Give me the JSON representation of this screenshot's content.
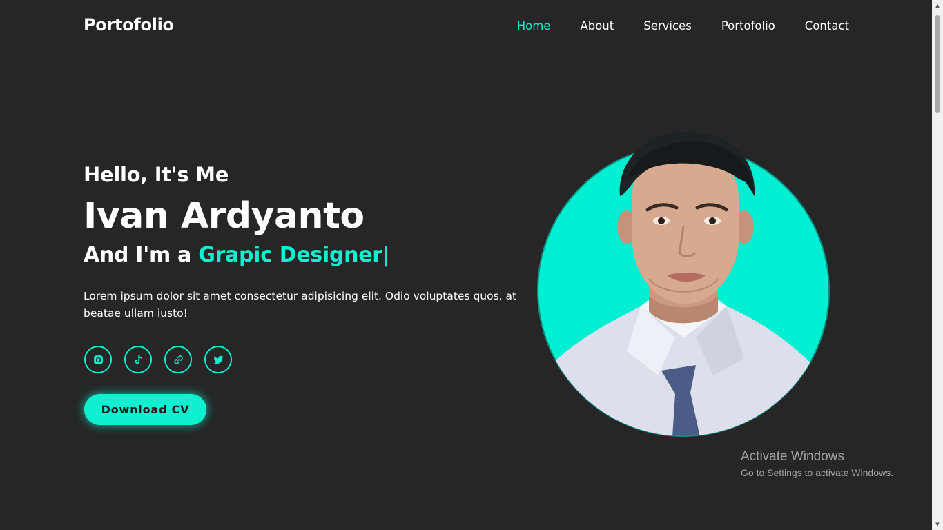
{
  "header": {
    "logo": "Portofolio",
    "nav": [
      {
        "label": "Home",
        "active": true
      },
      {
        "label": "About",
        "active": false
      },
      {
        "label": "Services",
        "active": false
      },
      {
        "label": "Portofolio",
        "active": false
      },
      {
        "label": "Contact",
        "active": false
      }
    ]
  },
  "hero": {
    "greeting": "Hello, It's Me",
    "name": "Ivan Ardyanto",
    "role_prefix": "And I'm a ",
    "role_highlight": "Grapic Designer",
    "role_cursor": "|",
    "description": "Lorem ipsum dolor sit amet consectetur adipisicing elit. Odio voluptates quos, at beatae ullam iusto!",
    "socials": [
      "instagram-icon",
      "tiktok-icon",
      "link-icon",
      "twitter-icon"
    ],
    "download_button": "Download CV"
  },
  "watermark": {
    "title": "Activate Windows",
    "subtitle": "Go to Settings to activate Windows."
  },
  "colors": {
    "background": "#262626",
    "accent": "#0ef0d0",
    "text": "#ffffff"
  }
}
